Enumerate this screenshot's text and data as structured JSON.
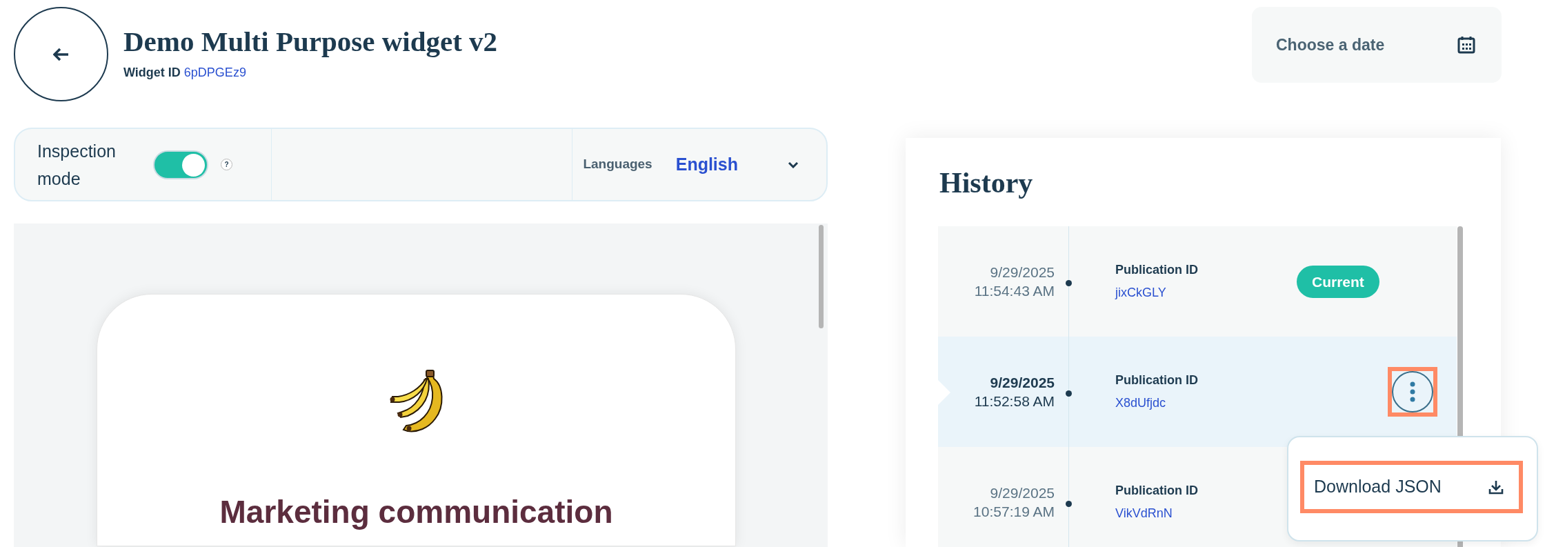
{
  "header": {
    "title": "Demo Multi Purpose widget v2",
    "widget_id_label": "Widget ID",
    "widget_id": "6pDPGEz9"
  },
  "date_picker": {
    "placeholder": "Choose a date"
  },
  "toolbar": {
    "inspection_label": "Inspection mode",
    "inspection_on": true,
    "help": "?",
    "languages_label": "Languages",
    "language": "English"
  },
  "preview": {
    "title": "Marketing communication"
  },
  "history": {
    "title": "History",
    "rows": [
      {
        "date": "9/29/2025",
        "time": "11:54:43 AM",
        "id_label": "Publication ID",
        "id": "jixCkGLY",
        "badge": "Current",
        "selected": false
      },
      {
        "date": "9/29/2025",
        "time": "11:52:58 AM",
        "id_label": "Publication ID",
        "id": "X8dUfjdc",
        "selected": true
      },
      {
        "date": "9/29/2025",
        "time": "10:57:19 AM",
        "id_label": "Publication ID",
        "id": "VikVdRnN",
        "selected": false
      }
    ],
    "menu": {
      "items": [
        {
          "label": "Download JSON"
        }
      ]
    }
  }
}
